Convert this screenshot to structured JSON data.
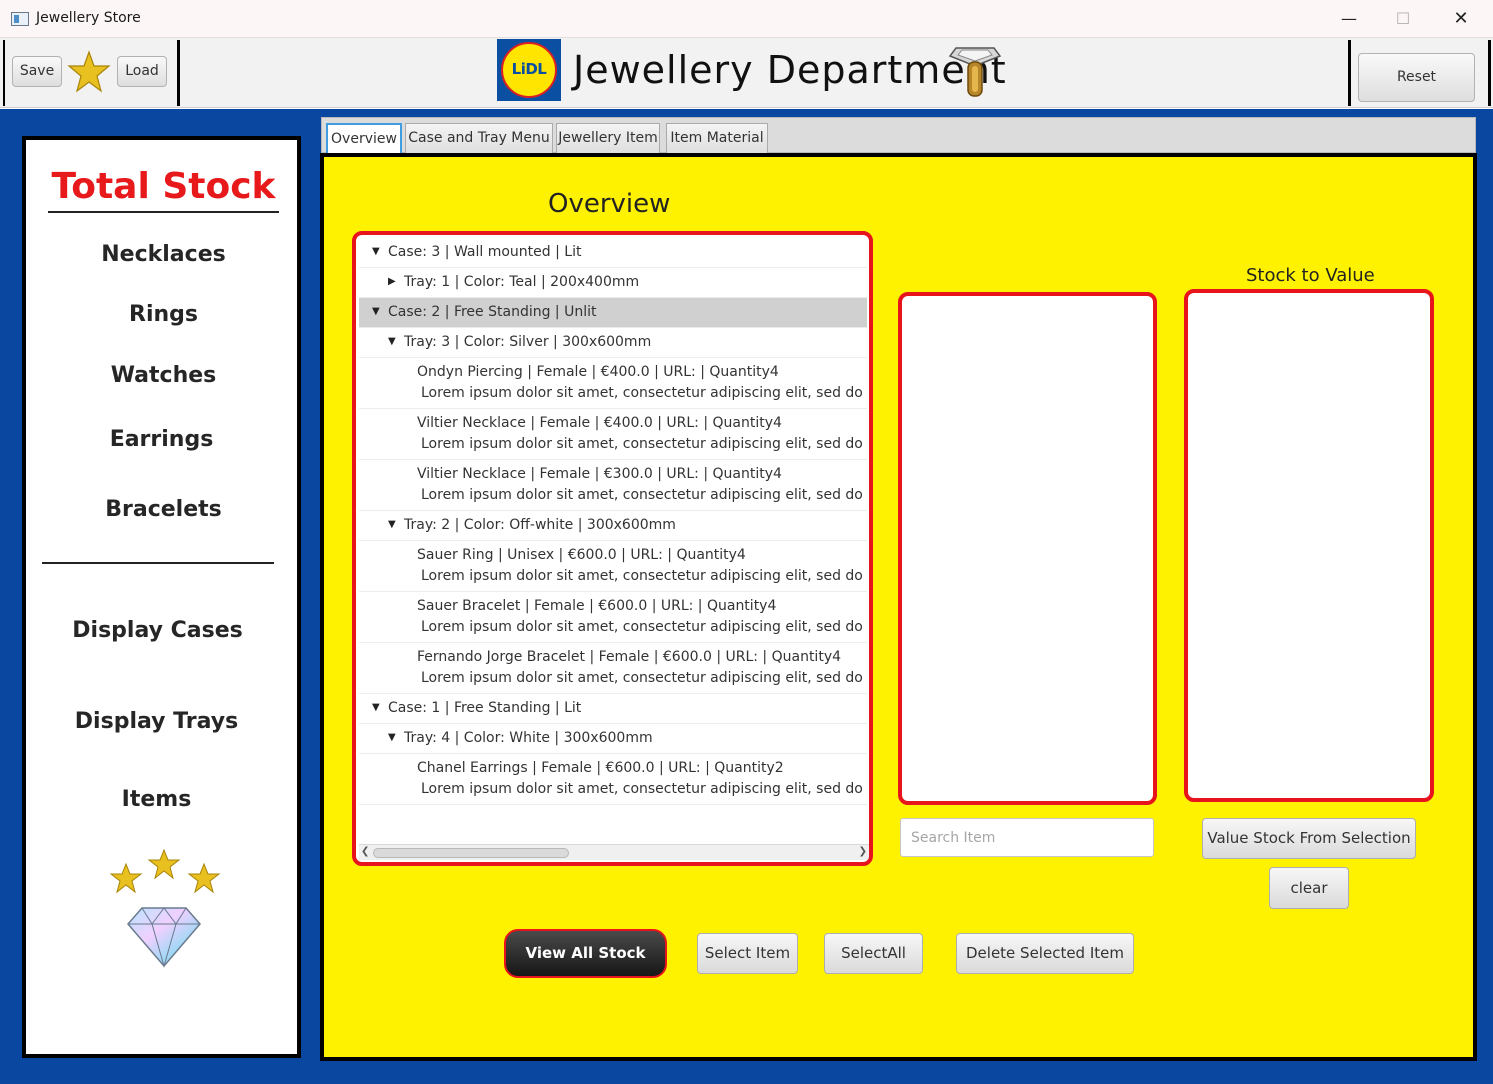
{
  "window": {
    "title": "Jewellery Store",
    "minimize": "—",
    "maximize": "☐",
    "close": "✕"
  },
  "header": {
    "save_label": "Save",
    "load_label": "Load",
    "reset_label": "Reset",
    "logo_text": "LiDL",
    "title": "Jewellery Department"
  },
  "sidebar": {
    "title": "Total Stock",
    "items": [
      "Necklaces",
      "Rings",
      "Watches",
      "Earrings",
      "Bracelets"
    ],
    "lower_items": [
      "Display Cases",
      "Display Trays",
      "Items"
    ]
  },
  "tabs": [
    "Overview",
    "Case and Tray Menu",
    "Jewellery Item",
    "Item Material"
  ],
  "overview": {
    "title": "Overview",
    "tree": {
      "case3": "Case:  3  |  Wall mounted   |   Lit",
      "case3_tray1": "Tray: 1  |  Color: Teal   |   200x400mm",
      "case2": "Case:  2  |  Free Standing   |   Unlit",
      "case2_tray3": "Tray: 3  |  Color: Silver   |   300x600mm",
      "case2_tray3_items": [
        {
          "line1": "Ondyn  Piercing    |    Female   |   €400.0  |   URL:   |  Quantity4",
          "line2": "Lorem ipsum dolor sit amet, consectetur adipiscing elit, sed do eiusmod"
        },
        {
          "line1": "Viltier  Necklace    |    Female   |   €400.0  |   URL:   |  Quantity4",
          "line2": "Lorem ipsum dolor sit amet, consectetur adipiscing elit, sed do eiusmod"
        },
        {
          "line1": "Viltier  Necklace    |    Female   |   €300.0  |   URL:   |  Quantity4",
          "line2": "Lorem ipsum dolor sit amet, consectetur adipiscing elit, sed do eiusmod"
        }
      ],
      "case2_tray2": "Tray: 2  |  Color: Off-white   |   300x600mm",
      "case2_tray2_items": [
        {
          "line1": "Sauer  Ring    |    Unisex  |   €600.0  |   URL:   |  Quantity4",
          "line2": "Lorem ipsum dolor sit amet, consectetur adipiscing elit, sed do eiusmod"
        },
        {
          "line1": "Sauer  Bracelet    |    Female   |   €600.0  |   URL:   |  Quantity4",
          "line2": "Lorem ipsum dolor sit amet, consectetur adipiscing elit, sed do eiusmod"
        },
        {
          "line1": "Fernando Jorge  Bracelet    |    Female   |   €600.0   |   URL:   |  Quantity4",
          "line2": "Lorem ipsum dolor sit amet, consectetur adipiscing elit, sed do eiusmod"
        }
      ],
      "case1": "Case:  1  |  Free Standing   |   Lit",
      "case1_tray4": "Tray: 4  |  Color: White   |   300x600mm",
      "case1_tray4_items": [
        {
          "line1": "Chanel  Earrings    |    Female   |   €600.0  |   URL:   |  Quantity2",
          "line2": "Lorem ipsum dolor sit amet, consectetur adipiscing elit, sed do eiusmod"
        }
      ]
    },
    "stock_to_value_label": "Stock to Value",
    "search_placeholder": "Search Item",
    "value_button": "Value Stock From Selection",
    "clear_button": "clear",
    "view_all_button": "View All Stock",
    "select_item_button": "Select Item",
    "select_all_button": "SelectAll",
    "delete_button": "Delete Selected Item"
  },
  "colors": {
    "accent_blue": "#0a47a0",
    "panel_yellow": "#fff200",
    "outline_red": "#e8141c",
    "title_red": "#e8191b"
  }
}
